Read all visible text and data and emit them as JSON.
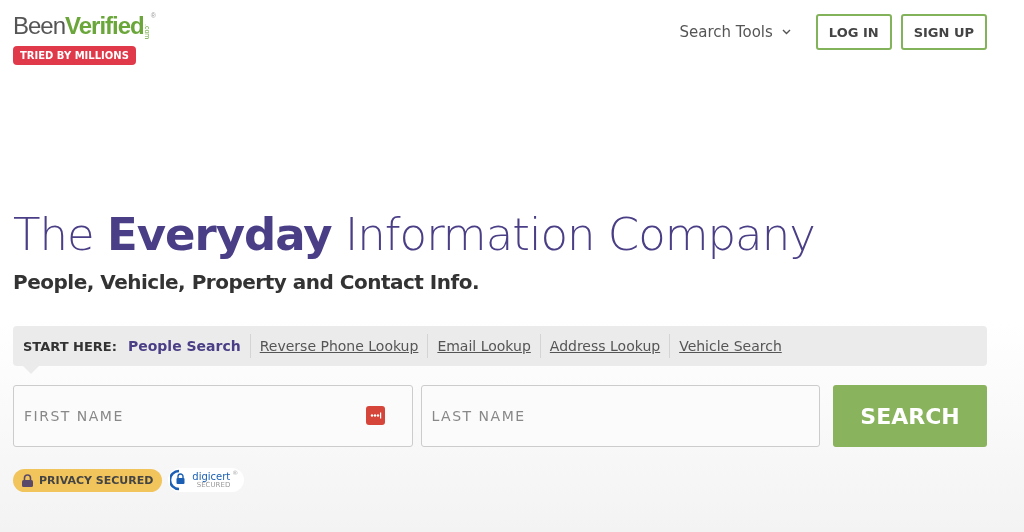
{
  "header": {
    "logo": {
      "part_1": "Been",
      "part_2": "Verified",
      "suffix": ".com",
      "registered": "®"
    },
    "badge": "TRIED BY MILLIONS",
    "nav": {
      "label": "Search Tools",
      "expanded": false
    },
    "buttons": [
      "LOG IN",
      "SIGN UP"
    ]
  },
  "hero": {
    "headline": "The **Everyday** Information Company",
    "subtitle": "People, Vehicle, Property and Contact Info."
  },
  "search": {
    "lead": "START HERE:",
    "tabs": [
      {
        "label": "People Search",
        "selected": true
      },
      {
        "label": "Reverse Phone Lookup",
        "selected": false
      },
      {
        "label": "Email Lookup",
        "selected": false
      },
      {
        "label": "Address Lookup",
        "selected": false
      },
      {
        "label": "Vehicle Search",
        "selected": false
      }
    ],
    "fields": [
      {
        "placeholder": "FIRST NAME",
        "kind": "autofill"
      },
      {
        "placeholder": "LAST NAME",
        "kind": "plain"
      }
    ],
    "button": "SEARCH"
  },
  "badges": {
    "privacy": "PRIVACY SECURED",
    "digicert": "digicert",
    "digicert_sub": "SECURED",
    "digicert_mark": "®"
  }
}
